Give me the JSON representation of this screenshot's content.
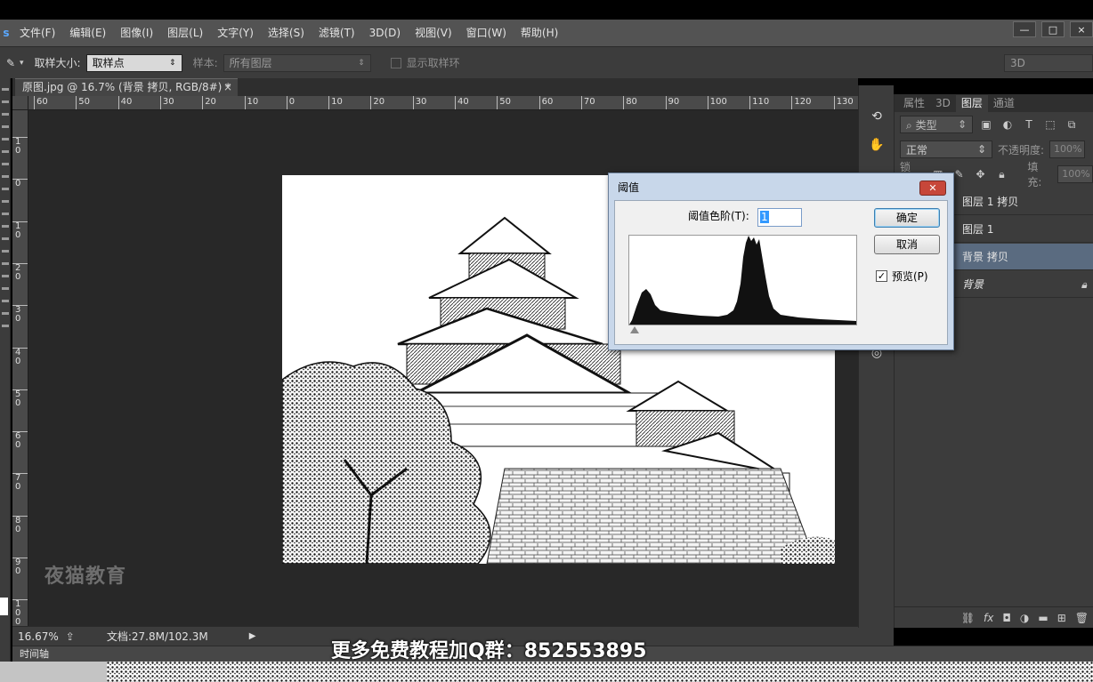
{
  "app": {
    "menu": [
      "文件(F)",
      "编辑(E)",
      "图像(I)",
      "图层(L)",
      "文字(Y)",
      "选择(S)",
      "滤镜(T)",
      "3D(D)",
      "视图(V)",
      "窗口(W)",
      "帮助(H)"
    ],
    "window_buttons": [
      "—",
      "□",
      "×"
    ]
  },
  "options": {
    "sample_size_label": "取样大小:",
    "sample_size_value": "取样点",
    "sample_label": "样本:",
    "sample_value": "所有图层",
    "show_ring_label": "显示取样环",
    "workspace_value": "3D"
  },
  "document": {
    "tab_title": "原图.jpg @ 16.7% (背景 拷贝, RGB/8#) *",
    "tab_close": "×",
    "ruler_h": [
      "60",
      "50",
      "40",
      "30",
      "20",
      "10",
      "0",
      "10",
      "20",
      "30",
      "40",
      "50",
      "60",
      "70",
      "80",
      "90",
      "100",
      "110",
      "120",
      "130"
    ],
    "ruler_v": [
      "1 0",
      "0",
      "1 0",
      "2 0",
      "3 0",
      "4 0",
      "5 0",
      "6 0",
      "7 0",
      "8 0",
      "9 0",
      "1 0 0"
    ],
    "watermark": "夜猫教育"
  },
  "status": {
    "zoom": "16.67%",
    "doc_size": "文档:27.8M/102.3M",
    "timeline": "时间轴"
  },
  "caption": "更多免费教程加Q群：852553895",
  "layers_panel": {
    "tabs": [
      "属性",
      "3D",
      "图层",
      "通道"
    ],
    "active_tab": "图层",
    "filter_kind": "类型",
    "blend_mode": "正常",
    "opacity_label": "不透明度:",
    "opacity_value": "100%",
    "lock_label": "锁定:",
    "fill_label": "填充:",
    "fill_value": "100%",
    "layers": [
      {
        "name": "图层 1 拷贝",
        "selected": false
      },
      {
        "name": "图层 1",
        "selected": false
      },
      {
        "name": "背景 拷贝",
        "selected": true
      },
      {
        "name": "背景",
        "selected": false,
        "locked": true
      }
    ]
  },
  "threshold_dialog": {
    "title": "阈值",
    "level_label": "阈值色阶(T):",
    "level_value": "1",
    "ok_label": "确定",
    "cancel_label": "取消",
    "preview_label": "预览(P)",
    "preview_checked": true
  }
}
